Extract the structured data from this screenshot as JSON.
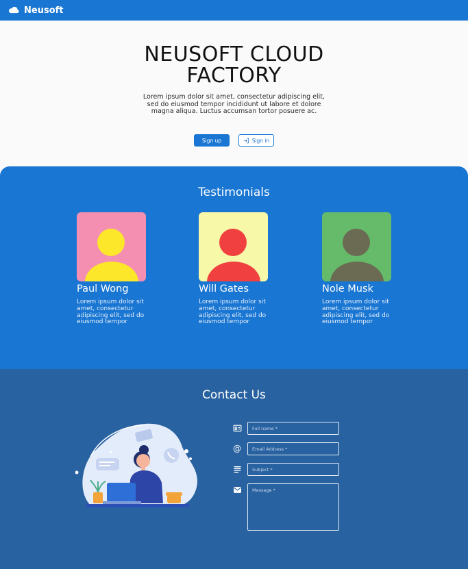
{
  "header": {
    "brand_name": "Neusoft",
    "brand_icon": "cloud-icon"
  },
  "hero": {
    "title_line1": "NEUSOFT CLOUD",
    "title_line2": "FACTORY",
    "description": "Lorem ipsum dolor sit amet, consectetur adipiscing elit, sed do eiusmod tempor incididunt ut labore et dolore magna aliqua. Luctus accumsan tortor posuere ac.",
    "signup_label": "Sign up",
    "signin_label": "Sign in",
    "signin_icon": "login-icon"
  },
  "testimonials": {
    "title": "Testimonials",
    "items": [
      {
        "name": "Paul Wong",
        "text": "Lorem ipsum dolor sit amet, consectetur adipiscing elit, sed do eiusmod tempor",
        "bg_color": "#f48fb1",
        "figure_color": "#fde72b"
      },
      {
        "name": "Will Gates",
        "text": "Lorem ipsum dolor sit amet, consectetur adipiscing elit, sed do eiusmod tempor",
        "bg_color": "#f7f9a8",
        "figure_color": "#f0403f"
      },
      {
        "name": "Nole Musk",
        "text": "Lorem ipsum dolor sit amet, consectetur adipiscing elit, sed do eiusmod tempor",
        "bg_color": "#66bb6a",
        "figure_color": "#6b6b54"
      }
    ]
  },
  "contact": {
    "title": "Contact Us",
    "fields": {
      "full_name_placeholder": "Full name *",
      "email_placeholder": "Email Address *",
      "subject_placeholder": "Subject *",
      "message_placeholder": "Message *"
    },
    "icons": [
      "id-card-icon",
      "at-sign-icon",
      "subject-lines-icon",
      "envelope-icon"
    ]
  },
  "colors": {
    "primary": "#1976d2",
    "contact_bg": "#2962a0",
    "page_bg": "#fafafa"
  }
}
